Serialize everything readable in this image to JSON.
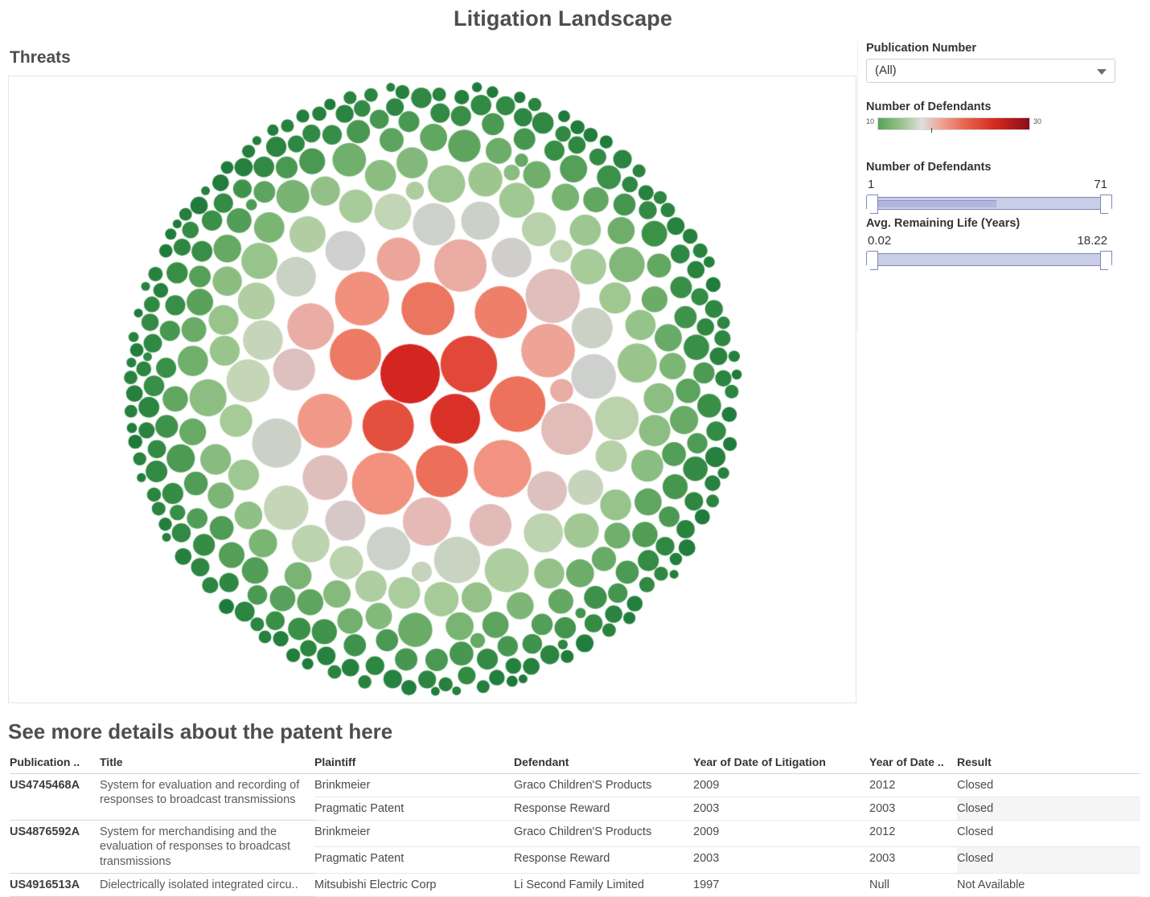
{
  "dashboard": {
    "title": "Litigation Landscape"
  },
  "threats": {
    "label": "Threats"
  },
  "controls": {
    "publication_filter": {
      "title": "Publication Number",
      "value": "(All)",
      "arrow_icon": "chevron-down-icon"
    },
    "color_legend": {
      "title": "Number of Defendants",
      "min": "10",
      "max": "30"
    },
    "defendants_slider": {
      "title": "Number of Defendants",
      "min": "1",
      "max": "71"
    },
    "life_slider": {
      "title": "Avg. Remaining Life (Years)",
      "min": "0.02",
      "max": "18.22"
    }
  },
  "details": {
    "title": "See more details about the patent here",
    "columns": [
      "Publication ..",
      "Title",
      "Plaintiff",
      "Defendant",
      "Year of Date of Litigation",
      "Year of Date ..",
      "Result"
    ],
    "rows": [
      {
        "publication": "US4745468A",
        "title": "System for evaluation and recording of responses to broadcast transmissions",
        "plaintiff": "Brinkmeier",
        "defendant": "Graco Children'S Products",
        "year_litigation": "2009",
        "year_date": "2012",
        "result": "Closed",
        "rowspan": 2,
        "alt": false
      },
      {
        "plaintiff": "Pragmatic Patent",
        "defendant": "Response Reward",
        "year_litigation": "2003",
        "year_date": "2003",
        "result": "Closed",
        "alt": true
      },
      {
        "publication": "US4876592A",
        "title": "System for merchandising and the evaluation of responses to broadcast transmissions",
        "plaintiff": "Brinkmeier",
        "defendant": "Graco Children'S Products",
        "year_litigation": "2009",
        "year_date": "2012",
        "result": "Closed",
        "rowspan": 2,
        "alt": false
      },
      {
        "plaintiff": "Pragmatic Patent",
        "defendant": "Response Reward",
        "year_litigation": "2003",
        "year_date": "2003",
        "result": "Closed",
        "alt": true
      },
      {
        "publication": "US4916513A",
        "title": "Dielectrically isolated integrated circu..",
        "plaintiff": "Mitsubishi Electric Corp",
        "defendant": "Li Second Family Limited",
        "year_litigation": "1997",
        "year_date": "Null",
        "result": "Not Available",
        "rowspan": 1,
        "alt": false
      }
    ]
  },
  "chart_data": {
    "type": "bubble",
    "title": "Threats",
    "packing": "circle-pack",
    "size_encoding": "Number of Defendants",
    "color_encoding": "Number of Defendants",
    "color_scale": {
      "type": "diverging",
      "domain": [
        10,
        30
      ],
      "stops": [
        "#1d7a3a",
        "#58a256",
        "#9dc48f",
        "#d6d6d6",
        "#efaa9c",
        "#ea6a53",
        "#d52d1f",
        "#8e0b19"
      ]
    },
    "center": [
      537,
      485
    ],
    "radius": 390,
    "bubble_count": 820,
    "max_bubble_radius": 38,
    "min_bubble_radius": 7,
    "notes": "Largest, darkest-red bubbles occupy the centre; bubble size and colour intensity decrease radially outward, ending in small dark-green circles at the perimeter."
  }
}
